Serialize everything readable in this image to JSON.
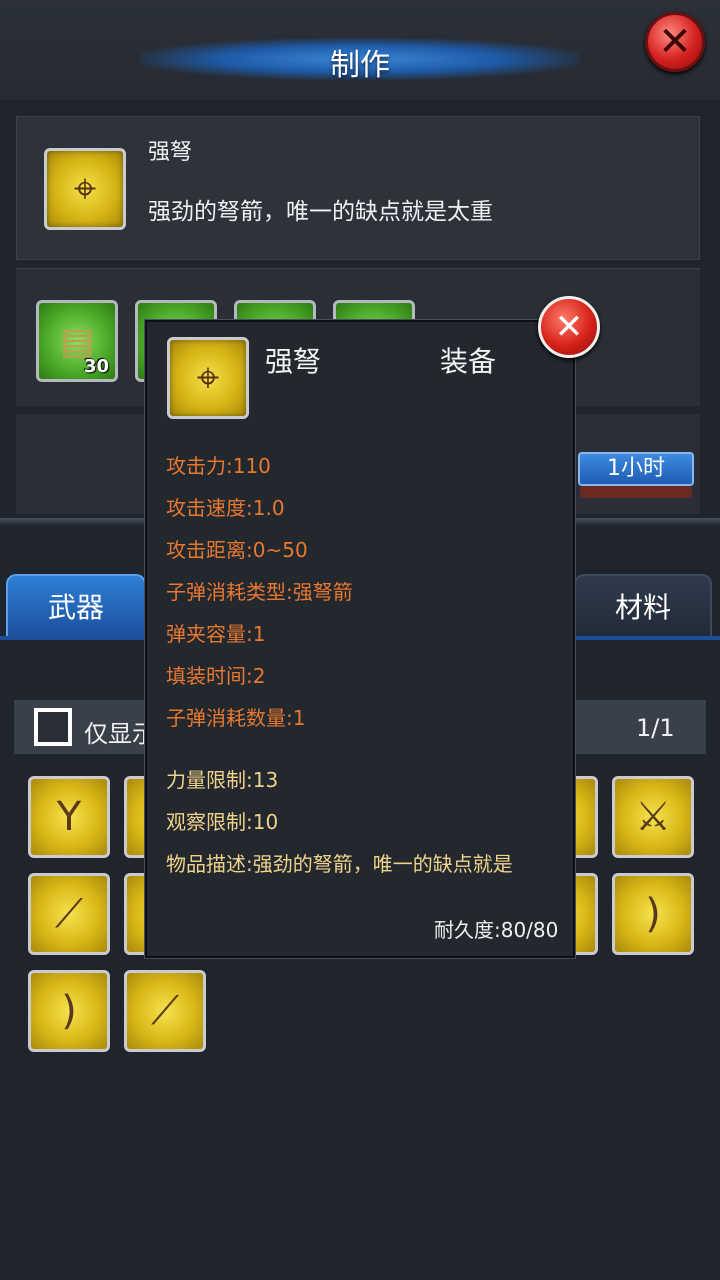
{
  "header": {
    "title": "制作"
  },
  "recipe": {
    "name": "强弩",
    "description": "强劲的弩箭，唯一的缺点就是太重",
    "icon": "crossbow-icon",
    "materials": [
      {
        "icon": "wood-planks-icon",
        "count": "30"
      },
      {
        "icon": "material-icon",
        "count": ""
      },
      {
        "icon": "material-icon",
        "count": ""
      },
      {
        "icon": "material-icon",
        "count": ""
      }
    ],
    "time_label": "1小时",
    "time_progress": 0
  },
  "tabs": {
    "weapon": "武器",
    "material": "材料"
  },
  "filter": {
    "label": "仅显示",
    "page": "1/1"
  },
  "grid": {
    "items": [
      "slingshot-icon",
      "item-icon",
      "item-icon",
      "sword-icon",
      "bat-icon",
      "item-icon",
      "item-icon",
      "bow-icon",
      "bow-icon",
      "stick-icon"
    ]
  },
  "popup": {
    "name": "强弩",
    "type": "装备",
    "stats": [
      "攻击力:110",
      "攻击速度:1.0",
      "攻击距离:0~50",
      "子弹消耗类型:强弩箭",
      "弹夹容量:1",
      "填装时间:2",
      "子弹消耗数量:1"
    ],
    "requirements": [
      "力量限制:13",
      "观察限制:10",
      "物品描述:强劲的弩箭，唯一的缺点就是"
    ],
    "durability": "耐久度:80/80"
  },
  "colors": {
    "stat": "#e8782e",
    "requirement": "#f0d38a",
    "accent": "#2d7fd6"
  }
}
